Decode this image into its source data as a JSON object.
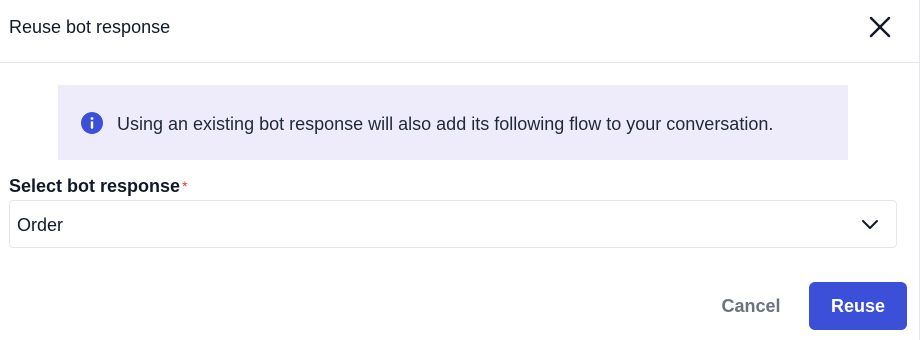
{
  "dialog": {
    "title": "Reuse bot response",
    "close_icon": "close-icon"
  },
  "info_banner": {
    "icon": "info-icon",
    "text": "Using an existing bot response will also add its following flow to your conversation.",
    "background_color": "#eeebfb",
    "icon_color": "#3b4fd8"
  },
  "bot_response_field": {
    "label": "Select bot response",
    "required_mark": "*",
    "selected_value": "Order",
    "dropdown_icon": "chevron-down-icon"
  },
  "footer": {
    "cancel_label": "Cancel",
    "reuse_label": "Reuse"
  },
  "colors": {
    "primary": "#3b4fd8",
    "required": "#e53935",
    "muted_text": "#6b7280"
  }
}
